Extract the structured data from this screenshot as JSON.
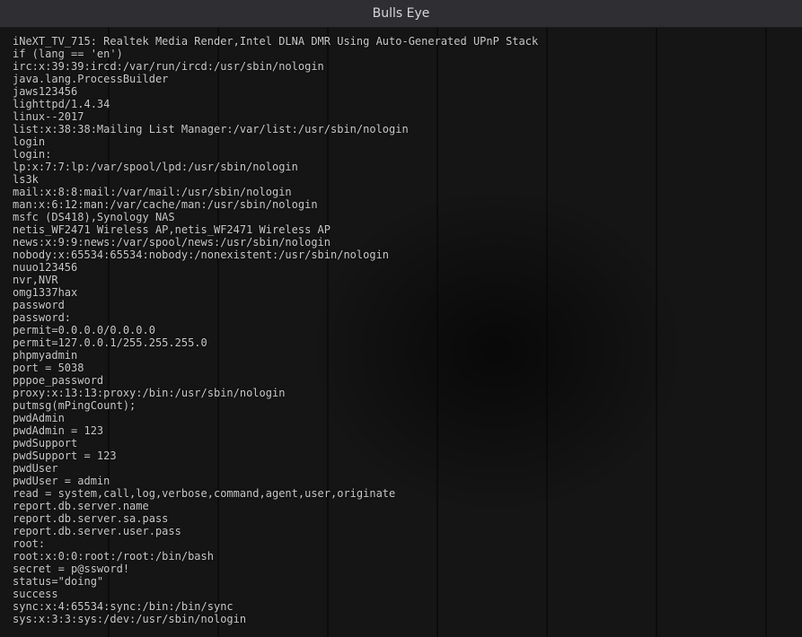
{
  "window": {
    "title": "Bulls Eye"
  },
  "lines": [
    "iNeXT_TV_715: Realtek Media Render,Intel DLNA DMR Using Auto-Generated UPnP Stack",
    "if (lang == 'en')",
    "irc:x:39:39:ircd:/var/run/ircd:/usr/sbin/nologin",
    "java.lang.ProcessBuilder",
    "jaws123456",
    "lighttpd/1.4.34",
    "linux--2017",
    "list:x:38:38:Mailing List Manager:/var/list:/usr/sbin/nologin",
    "login",
    "login:",
    "lp:x:7:7:lp:/var/spool/lpd:/usr/sbin/nologin",
    "ls3k",
    "mail:x:8:8:mail:/var/mail:/usr/sbin/nologin",
    "man:x:6:12:man:/var/cache/man:/usr/sbin/nologin",
    "msfc (DS418),Synology NAS",
    "netis_WF2471 Wireless AP,netis_WF2471 Wireless AP",
    "news:x:9:9:news:/var/spool/news:/usr/sbin/nologin",
    "nobody:x:65534:65534:nobody:/nonexistent:/usr/sbin/nologin",
    "nuuo123456",
    "nvr,NVR",
    "omg1337hax",
    "password",
    "password:",
    "permit=0.0.0.0/0.0.0.0",
    "permit=127.0.0.1/255.255.255.0",
    "phpmyadmin",
    "port = 5038",
    "pppoe_password",
    "proxy:x:13:13:proxy:/bin:/usr/sbin/nologin",
    "putmsg(mPingCount);",
    "pwdAdmin",
    "pwdAdmin = 123",
    "pwdSupport",
    "pwdSupport = 123",
    "pwdUser",
    "pwdUser = admin",
    "read = system,call,log,verbose,command,agent,user,originate",
    "report.db.server.name",
    "report.db.server.sa.pass",
    "report.db.server.user.pass",
    "root:",
    "root:x:0:0:root:/root:/bin/bash",
    "secret = p@ssword!",
    "status=\"doing\"",
    "success",
    "sync:x:4:65534:sync:/bin:/bin/sync",
    "sys:x:3:3:sys:/dev:/usr/sbin/nologin"
  ]
}
